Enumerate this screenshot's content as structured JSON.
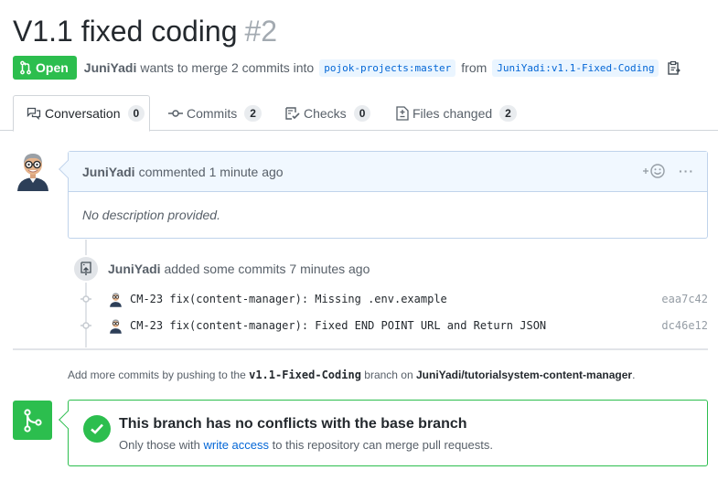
{
  "pr": {
    "title": "V1.1 fixed coding",
    "number": "#2",
    "state": "Open",
    "author": "JuniYadi",
    "merge_text": "wants to merge 2 commits into",
    "base_branch": "pojok-projects:master",
    "from_text": "from",
    "head_branch": "JuniYadi:v1.1-Fixed-Coding"
  },
  "tabs": [
    {
      "label": "Conversation",
      "count": "0"
    },
    {
      "label": "Commits",
      "count": "2"
    },
    {
      "label": "Checks",
      "count": "0"
    },
    {
      "label": "Files changed",
      "count": "2"
    }
  ],
  "comment": {
    "author": "JuniYadi",
    "action": "commented",
    "time": "1 minute ago",
    "body": "No description provided.",
    "reaction_icon": "smiley-icon",
    "more_label": "···"
  },
  "commit_event": {
    "author": "JuniYadi",
    "action": "added some commits",
    "time": "7 minutes ago",
    "commits": [
      {
        "message": "CM-23 fix(content-manager): Missing .env.example",
        "sha": "eaa7c42"
      },
      {
        "message": "CM-23 fix(content-manager): Fixed END POINT URL and Return JSON",
        "sha": "dc46e12"
      }
    ]
  },
  "hint": {
    "prefix": "Add more commits by pushing to the",
    "branch": "v1.1-Fixed-Coding",
    "middle": "branch on",
    "repo": "JuniYadi/tutorialsystem-content-manager",
    "suffix": "."
  },
  "merge": {
    "title": "This branch has no conflicts with the base branch",
    "sub_prefix": "Only those with",
    "sub_link": "write access",
    "sub_suffix": "to this repository can merge pull requests."
  },
  "colors": {
    "green": "#2cbe4e",
    "link": "#0366d6",
    "muted": "#586069"
  }
}
